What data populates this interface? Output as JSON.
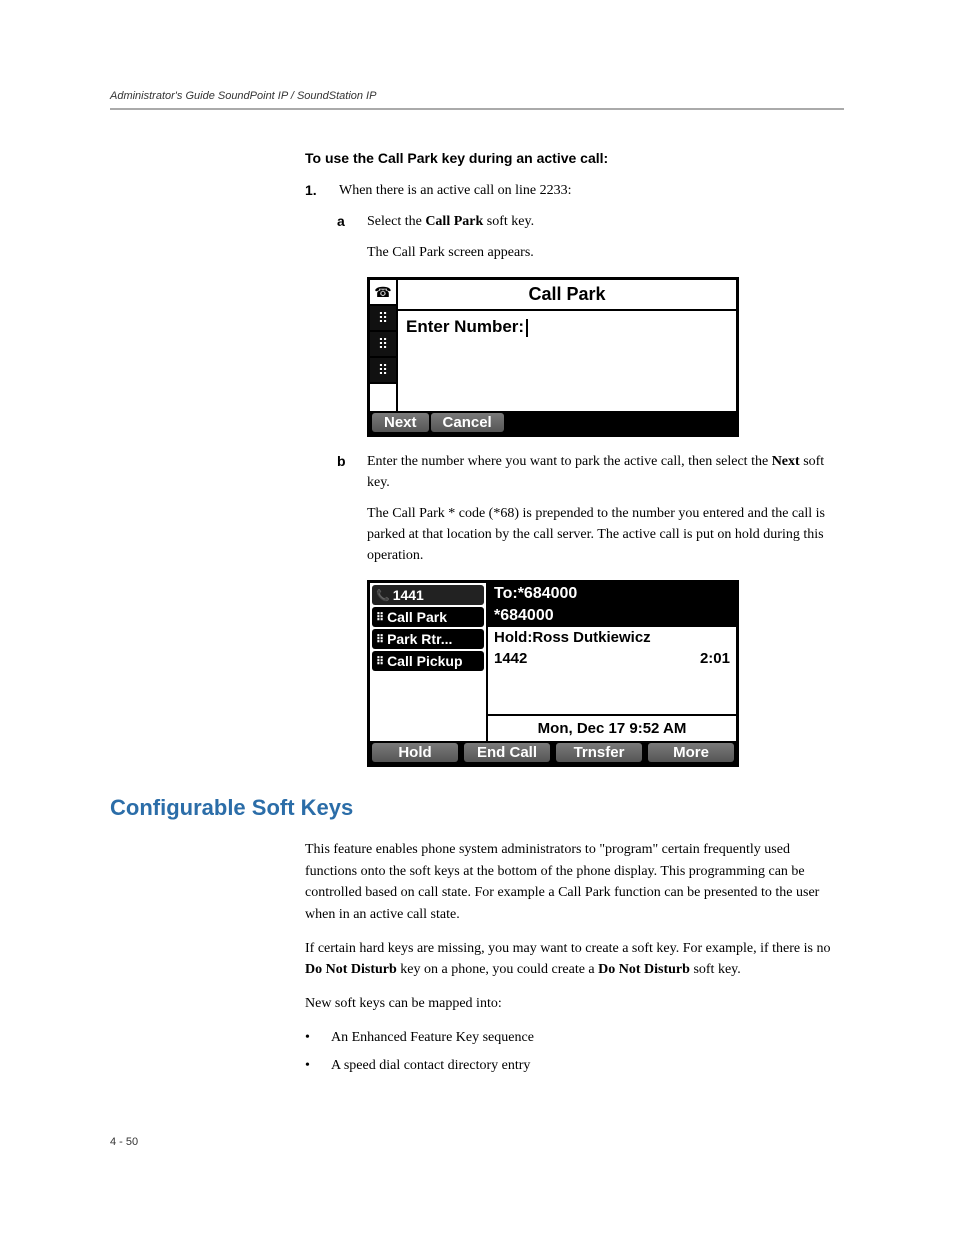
{
  "header": "Administrator's Guide SoundPoint IP / SoundStation IP",
  "heading1": "To use the Call Park key during an active call:",
  "step1_marker": "1.",
  "step1_text": "When there is an active call on line 2233:",
  "sub_a_marker": "a",
  "sub_a_prefix": "Select the ",
  "sub_a_bold": "Call Park",
  "sub_a_suffix": " soft key.",
  "sub_a_follow": "The Call Park screen appears.",
  "phone1": {
    "title": "Call Park",
    "prompt": "Enter Number:",
    "soft_next": "Next",
    "soft_cancel": "Cancel"
  },
  "sub_b_marker": "b",
  "sub_b_prefix": "Enter the number where you want to park the active call, then select the ",
  "sub_b_bold": "Next",
  "sub_b_suffix": " soft key.",
  "sub_b_follow": "The Call Park * code (*68) is prepended to the number you entered and the call is parked at that location by the call server. The active call is put on hold during this operation.",
  "phone2": {
    "line": "1441",
    "tabs": [
      "Call Park",
      "Park Rtr...",
      "Call Pickup"
    ],
    "to": "To:*684000",
    "num": "*684000",
    "hold": "Hold:Ross Dutkiewicz",
    "ext": "1442",
    "dur": "2:01",
    "date": "Mon, Dec 17  9:52 AM",
    "soft": [
      "Hold",
      "End Call",
      "Trnsfer",
      "More"
    ]
  },
  "h2": "Configurable Soft Keys",
  "para1": "This feature enables phone system administrators to \"program\" certain frequently used functions onto the soft keys at the bottom of the phone display. This programming can be controlled based on call state. For example a Call Park function can be presented to the user when in an active call state.",
  "para2_prefix": "If certain hard keys are missing, you may want to create a soft key. For example, if there is no ",
  "para2_bold1": "Do Not Disturb",
  "para2_mid": " key on a phone, you could create a ",
  "para2_bold2": "Do Not Disturb",
  "para2_suffix": " soft key.",
  "para3": "New soft keys can be mapped into:",
  "bullets": [
    "An Enhanced Feature Key sequence",
    "A speed dial contact directory entry"
  ],
  "page_num": "4 - 50"
}
